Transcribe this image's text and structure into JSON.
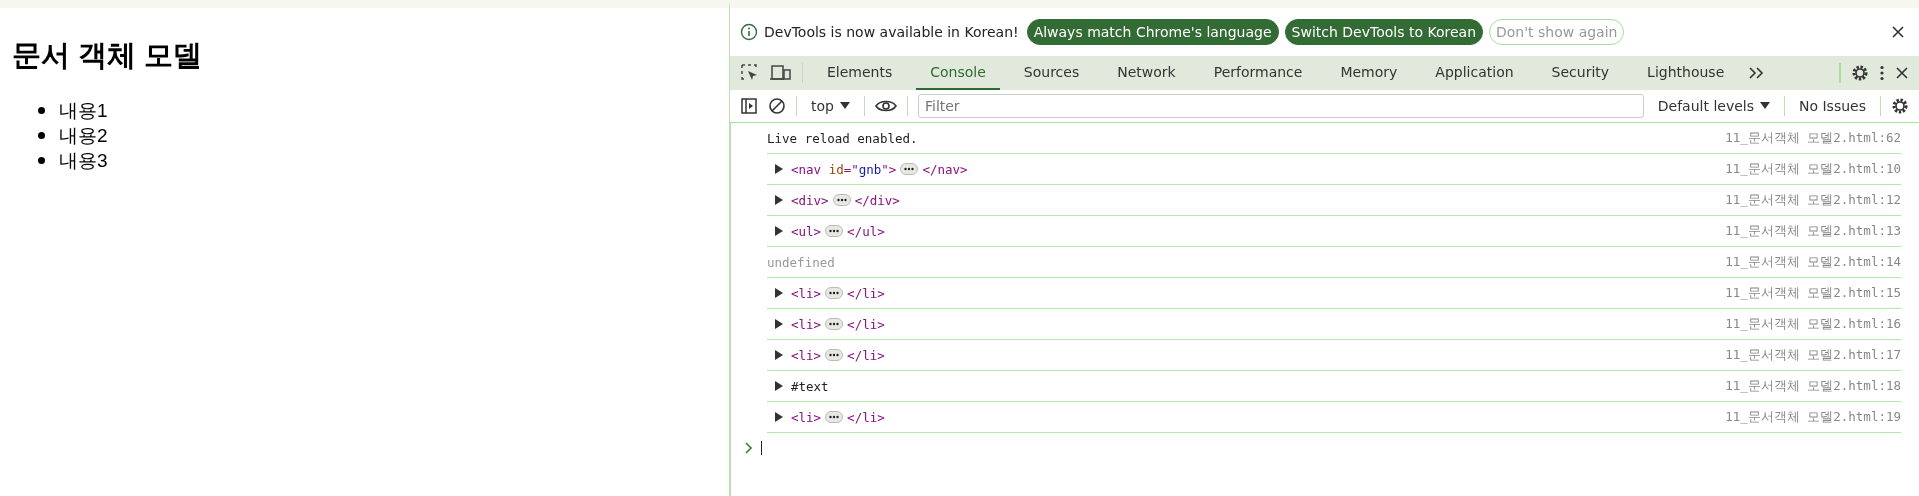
{
  "page": {
    "heading": "문서 객체 모델",
    "items": [
      "내용1",
      "내용2",
      "내용3"
    ]
  },
  "devtools": {
    "infobar": {
      "message": "DevTools is now available in Korean!",
      "buttons": [
        {
          "label": "Always match Chrome's language",
          "kind": "primary"
        },
        {
          "label": "Switch DevTools to Korean",
          "kind": "primary"
        },
        {
          "label": "Don't show again",
          "kind": "outline"
        }
      ]
    },
    "tabs": [
      {
        "label": "Elements",
        "selected": false
      },
      {
        "label": "Console",
        "selected": true
      },
      {
        "label": "Sources",
        "selected": false
      },
      {
        "label": "Network",
        "selected": false
      },
      {
        "label": "Performance",
        "selected": false
      },
      {
        "label": "Memory",
        "selected": false
      },
      {
        "label": "Application",
        "selected": false
      },
      {
        "label": "Security",
        "selected": false
      },
      {
        "label": "Lighthouse",
        "selected": false
      }
    ],
    "toolbar": {
      "context": "top",
      "filter_placeholder": "Filter",
      "levels": "Default levels",
      "issues": "No Issues"
    },
    "messages": [
      {
        "kind": "log",
        "text": "Live reload enabled.",
        "source": "11_문서객체 모델2.html:62"
      },
      {
        "kind": "element",
        "parts": [
          {
            "kind": "tag",
            "text": "<nav"
          },
          {
            "kind": "attr",
            "text": " id"
          },
          {
            "kind": "tag",
            "text": "=\""
          },
          {
            "kind": "value",
            "text": "gnb"
          },
          {
            "kind": "tag",
            "text": "\">"
          }
        ],
        "close": "</nav>",
        "source": "11_문서객체 모델2.html:10"
      },
      {
        "kind": "element",
        "parts": [
          {
            "kind": "tag",
            "text": "<div>"
          }
        ],
        "close": "</div>",
        "source": "11_문서객체 모델2.html:12"
      },
      {
        "kind": "element",
        "parts": [
          {
            "kind": "tag",
            "text": "<ul>"
          }
        ],
        "close": "</ul>",
        "source": "11_문서객체 모델2.html:13"
      },
      {
        "kind": "undefined",
        "text": "undefined",
        "source": "11_문서객체 모델2.html:14"
      },
      {
        "kind": "element",
        "parts": [
          {
            "kind": "tag",
            "text": "<li>"
          }
        ],
        "close": "</li>",
        "source": "11_문서객체 모델2.html:15"
      },
      {
        "kind": "element",
        "parts": [
          {
            "kind": "tag",
            "text": "<li>"
          }
        ],
        "close": "</li>",
        "source": "11_문서객체 모델2.html:16"
      },
      {
        "kind": "element",
        "parts": [
          {
            "kind": "tag",
            "text": "<li>"
          }
        ],
        "close": "</li>",
        "source": "11_문서객체 모델2.html:17"
      },
      {
        "kind": "node",
        "text": "#text",
        "source": "11_문서객체 모델2.html:18"
      },
      {
        "kind": "element",
        "parts": [
          {
            "kind": "tag",
            "text": "<li>"
          }
        ],
        "close": "</li>",
        "source": "11_문서객체 모델2.html:19"
      }
    ]
  }
}
